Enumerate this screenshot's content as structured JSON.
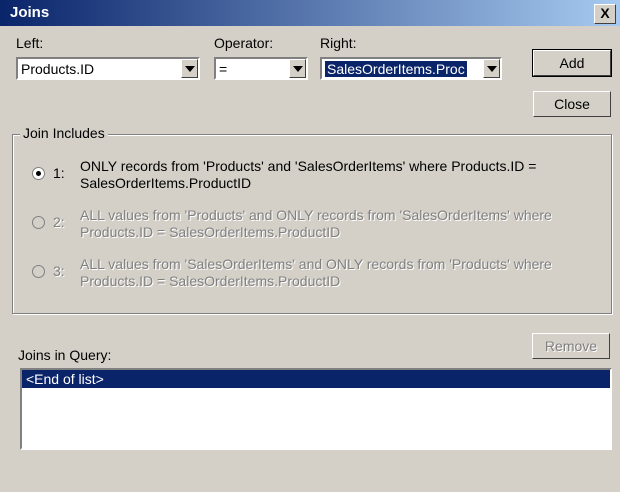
{
  "window": {
    "title": "Joins",
    "close_glyph": "X"
  },
  "left": {
    "label": "Left:",
    "value": "Products.ID"
  },
  "operator": {
    "label": "Operator:",
    "value": "="
  },
  "right": {
    "label": "Right:",
    "value": "SalesOrderItems.Proc"
  },
  "buttons": {
    "add": "Add",
    "close": "Close",
    "remove": "Remove"
  },
  "group": {
    "title": "Join Includes",
    "options": [
      {
        "num": "1:",
        "text": "ONLY records from 'Products' and 'SalesOrderItems' where Products.ID = SalesOrderItems.ProductID",
        "selected": true,
        "enabled": true
      },
      {
        "num": "2:",
        "text": "ALL values from 'Products' and ONLY records from 'SalesOrderItems' where Products.ID = SalesOrderItems.ProductID",
        "selected": false,
        "enabled": false
      },
      {
        "num": "3:",
        "text": "ALL values from 'SalesOrderItems' and ONLY records from 'Products' where Products.ID = SalesOrderItems.ProductID",
        "selected": false,
        "enabled": false
      }
    ]
  },
  "joins_list": {
    "label": "Joins in Query:",
    "items": [
      "<End of list>"
    ]
  }
}
